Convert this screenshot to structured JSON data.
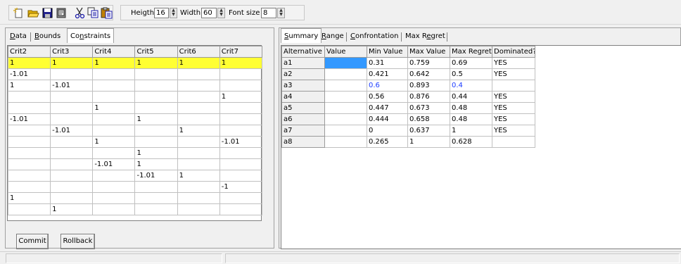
{
  "toolbar": {
    "icons": [
      "new-icon",
      "open-icon",
      "save-icon",
      "copy-document-icon",
      "cut-icon",
      "copy-icon",
      "paste-icon"
    ],
    "height_label": "Heigth",
    "height_value": "16",
    "width_label": "Width",
    "width_value": "60",
    "fontsize_label": "Font size",
    "fontsize_value": "8"
  },
  "left_panel": {
    "tabs": [
      "Data",
      "Bounds",
      "Constraints"
    ],
    "active_tab": "Constraints",
    "columns": [
      "Crit2",
      "Crit3",
      "Crit4",
      "Crit5",
      "Crit6",
      "Crit7"
    ],
    "rows": [
      [
        "1",
        "1",
        "1",
        "1",
        "1",
        "1"
      ],
      [
        "-1.01",
        "",
        "",
        "",
        "",
        ""
      ],
      [
        "1",
        "-1.01",
        "",
        "",
        "",
        ""
      ],
      [
        "",
        "",
        "",
        "",
        "",
        "1"
      ],
      [
        "",
        "",
        "1",
        "",
        "",
        ""
      ],
      [
        "-1.01",
        "",
        "",
        "1",
        "",
        ""
      ],
      [
        "",
        "-1.01",
        "",
        "",
        "1",
        ""
      ],
      [
        "",
        "",
        "1",
        "",
        "",
        "-1.01"
      ],
      [
        "",
        "",
        "",
        "1",
        "",
        ""
      ],
      [
        "",
        "",
        "-1.01",
        "1",
        "",
        ""
      ],
      [
        "",
        "",
        "",
        "-1.01",
        "1",
        ""
      ],
      [
        "",
        "",
        "",
        "",
        "",
        "-1"
      ],
      [
        "1",
        "",
        "",
        "",
        "",
        ""
      ],
      [
        "",
        "1",
        "",
        "",
        "",
        ""
      ]
    ],
    "commit_label": "Commit",
    "rollback_label": "Rollback"
  },
  "right_panel": {
    "tabs": [
      "Summary",
      "Range",
      "Confrontation",
      "Max Regret"
    ],
    "active_tab": "Summary",
    "columns": [
      "Alternative",
      "Value",
      "Min Value",
      "Max Value",
      "Max Regret",
      "Dominated?"
    ],
    "rows": [
      [
        "a1",
        "",
        "0.31",
        "0.759",
        "0.69",
        "YES"
      ],
      [
        "a2",
        "",
        "0.421",
        "0.642",
        "0.5",
        "YES"
      ],
      [
        "a3",
        "",
        "0.6",
        "0.893",
        "0.4",
        ""
      ],
      [
        "a4",
        "",
        "0.56",
        "0.876",
        "0.44",
        "YES"
      ],
      [
        "a5",
        "",
        "0.447",
        "0.673",
        "0.48",
        "YES"
      ],
      [
        "a6",
        "",
        "0.444",
        "0.658",
        "0.48",
        "YES"
      ],
      [
        "a7",
        "",
        "0",
        "0.637",
        "1",
        "YES"
      ],
      [
        "a8",
        "",
        "0.265",
        "1",
        "0.628",
        ""
      ]
    ]
  },
  "colors": {
    "highlight_row": "#ffff33",
    "selected_cell": "#3399ff",
    "blue_text": "#1c3cff"
  }
}
